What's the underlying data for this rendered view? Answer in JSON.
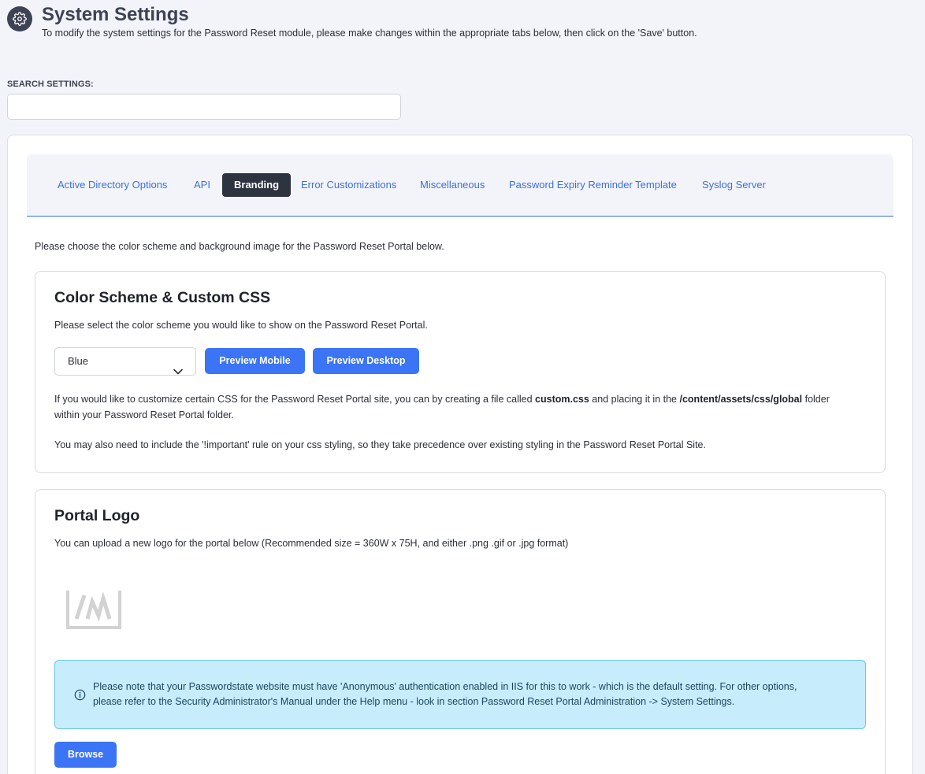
{
  "header": {
    "icon": "gear-icon",
    "title": "System Settings",
    "subtitle": "To modify the system settings for the Password Reset module, please make changes within the appropriate tabs below, then click on the 'Save' button."
  },
  "search": {
    "label": "SEARCH SETTINGS:",
    "value": "",
    "placeholder": ""
  },
  "tabs": [
    {
      "label": "Active Directory Options",
      "active": false
    },
    {
      "label": "API",
      "active": false
    },
    {
      "label": "Branding",
      "active": true
    },
    {
      "label": "Error Customizations",
      "active": false
    },
    {
      "label": "Miscellaneous",
      "active": false
    },
    {
      "label": "Password Expiry Reminder Template",
      "active": false
    },
    {
      "label": "Syslog Server",
      "active": false
    }
  ],
  "intro": "Please choose the color scheme and background image for the Password Reset Portal below.",
  "color_card": {
    "title": "Color Scheme & Custom CSS",
    "description": "Please select the color scheme you would like to show on the Password Reset Portal.",
    "scheme_value": "Blue",
    "preview_mobile": "Preview Mobile",
    "preview_desktop": "Preview Desktop",
    "css_text_1": "If you would like to customize certain CSS for the Password Reset Portal site, you can by creating a file called",
    "css_file": "custom.css",
    "css_text_2": "and placing it in the",
    "css_folder": "/content/assets/css/global",
    "css_text_3": "folder",
    "css_text_4": "within your Password Reset Portal folder.",
    "important_text": "You may also need to include the '!important' rule on your css styling, so they take precedence over existing styling in the Password Reset Portal Site."
  },
  "logo_card": {
    "title": "Portal Logo",
    "description": "You can upload a new logo for the portal below (Recommended size = 360W x 75H, and either .png .gif or .jpg format)",
    "alert_line_1": "Please note that your Passwordstate website must have 'Anonymous' authentication enabled in IIS for this to work - which is the default setting. For other options,",
    "alert_line_2": "please refer to the Security Administrator's Manual under the Help menu - look in section Password Reset Portal Administration -> System Settings.",
    "browse_label": "Browse"
  },
  "colors": {
    "accent": "#3b74f5",
    "tab_active_bg": "#2e3340",
    "alert_bg": "#c7ecfb"
  }
}
